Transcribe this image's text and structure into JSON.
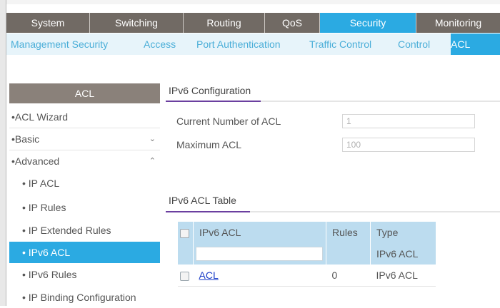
{
  "main_tabs": [
    "System",
    "Switching",
    "Routing",
    "QoS",
    "Security",
    "Monitoring"
  ],
  "sub_tabs": [
    "Management Security",
    "Access",
    "Port Authentication",
    "Traffic Control",
    "Control",
    "ACL"
  ],
  "sidebar": {
    "header": "ACL",
    "items": [
      {
        "label": "ACL Wizard",
        "bullet": "•"
      },
      {
        "label": "Basic",
        "bullet": "•"
      },
      {
        "label": "Advanced",
        "bullet": "•"
      },
      {
        "label": "IP ACL",
        "bullet": "•"
      },
      {
        "label": "IP Rules",
        "bullet": "•"
      },
      {
        "label": "IP Extended Rules",
        "bullet": "•"
      },
      {
        "label": "IPv6 ACL",
        "bullet": "•"
      },
      {
        "label": "IPv6 Rules",
        "bullet": "•"
      },
      {
        "label": "IP Binding Configuration",
        "bullet": "•"
      }
    ]
  },
  "config": {
    "title": "IPv6 Configuration",
    "current_label": "Current Number of ACL",
    "current_value": "1",
    "max_label": "Maximum ACL",
    "max_value": "100"
  },
  "table": {
    "title": "IPv6 ACL Table",
    "headers": [
      "IPv6 ACL",
      "Rules",
      "Type"
    ],
    "filter_type": "IPv6 ACL",
    "rows": [
      {
        "name": "ACL",
        "rules": "0",
        "type": "IPv6 ACL"
      }
    ]
  },
  "colors": {
    "accent": "#2baae2",
    "tab_bar": "#716a64",
    "table_header": "#bcdcef",
    "section_accent": "#6b3fa0"
  }
}
